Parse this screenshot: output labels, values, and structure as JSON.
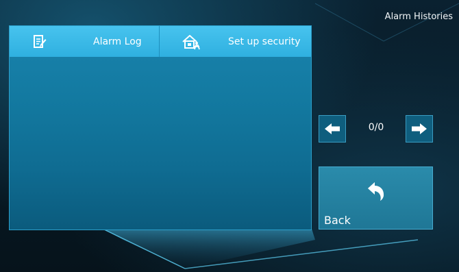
{
  "header": {
    "title": "Alarm Histories"
  },
  "tabs": [
    {
      "label": "Alarm Log",
      "icon": "edit-notes-icon"
    },
    {
      "label": "Set up security",
      "icon": "home-security-icon"
    }
  ],
  "pager": {
    "count": "0/0",
    "prev_icon": "arrow-left-icon",
    "next_icon": "arrow-right-icon"
  },
  "back": {
    "label": "Back",
    "icon": "return-arrow-icon"
  },
  "colors": {
    "tab_bar": "#3bbbe9",
    "panel": "#137aa1",
    "button": "#0f5e7e"
  }
}
